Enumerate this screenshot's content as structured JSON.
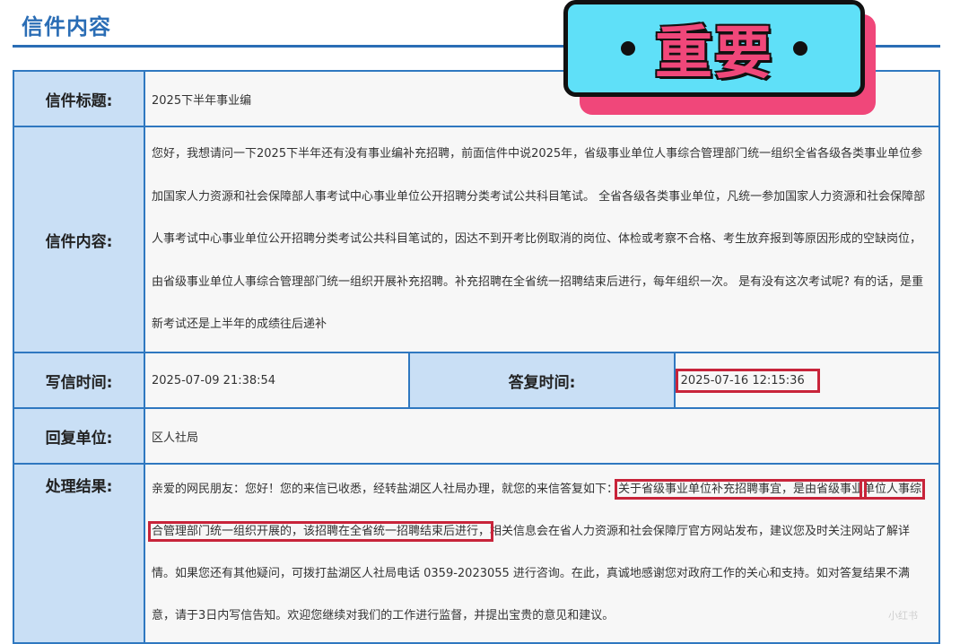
{
  "header": {
    "title": "信件内容"
  },
  "badge": {
    "text": "重要",
    "dot_left": "•",
    "dot_right": "•",
    "colors": {
      "fill": "#5fe0f8",
      "text": "#f0477a",
      "shadow": "#f0477a"
    }
  },
  "rows": {
    "subject": {
      "label": "信件标题:",
      "value": "2025下半年事业编"
    },
    "content": {
      "label": "信件内容:",
      "value": "您好，我想请问一下2025下半年还有没有事业编补充招聘，前面信件中说2025年，省级事业单位人事综合管理部门统一组织全省各级各类事业单位参加国家人力资源和社会保障部人事考试中心事业单位公开招聘分类考试公共科目笔试。 全省各级各类事业单位，凡统一参加国家人力资源和社会保障部人事考试中心事业单位公开招聘分类考试公共科目笔试的，因达不到开考比例取消的岗位、体检或考察不合格、考生放弃报到等原因形成的空缺岗位，由省级事业单位人事综合管理部门统一组织开展补充招聘。补充招聘在全省统一招聘结束后进行，每年组织一次。 是有没有这次考试呢? 有的话，是重新考试还是上半年的成绩往后递补"
    },
    "times": {
      "write_label": "写信时间:",
      "write_value": "2025-07-09 21:38:54",
      "reply_label": "答复时间:",
      "reply_value": "2025-07-16 12:15:36"
    },
    "unit": {
      "label": "回复单位:",
      "value": "区人社局"
    },
    "result": {
      "label": "处理结果:",
      "part1": "亲爱的网民朋友：您好！您的来信已收悉，经转盐湖区人社局办理，就您的来信答复如下：",
      "highlight_a": "关于省级事业单位补充招聘事宜，是由省级事业",
      "highlight_b": "单位人事综合管理部门统一组织开展的，该招聘在全省统一招聘结束后进行，",
      "part2": "相关信息会在省人力资源和社会保障厅官方网站发布，建议您及时关注网站了解详情。如果您还有其他疑问，可拨打盐湖区人社局电话 0359-2023055 进行咨询。在此，真诚地感谢您对政府工作的关心和支持。如对答复结果不满意，请于3日内写信告知。欢迎您继续对我们的工作进行监督，并提出宝贵的意见和建议。"
    }
  },
  "watermark": "小红书"
}
